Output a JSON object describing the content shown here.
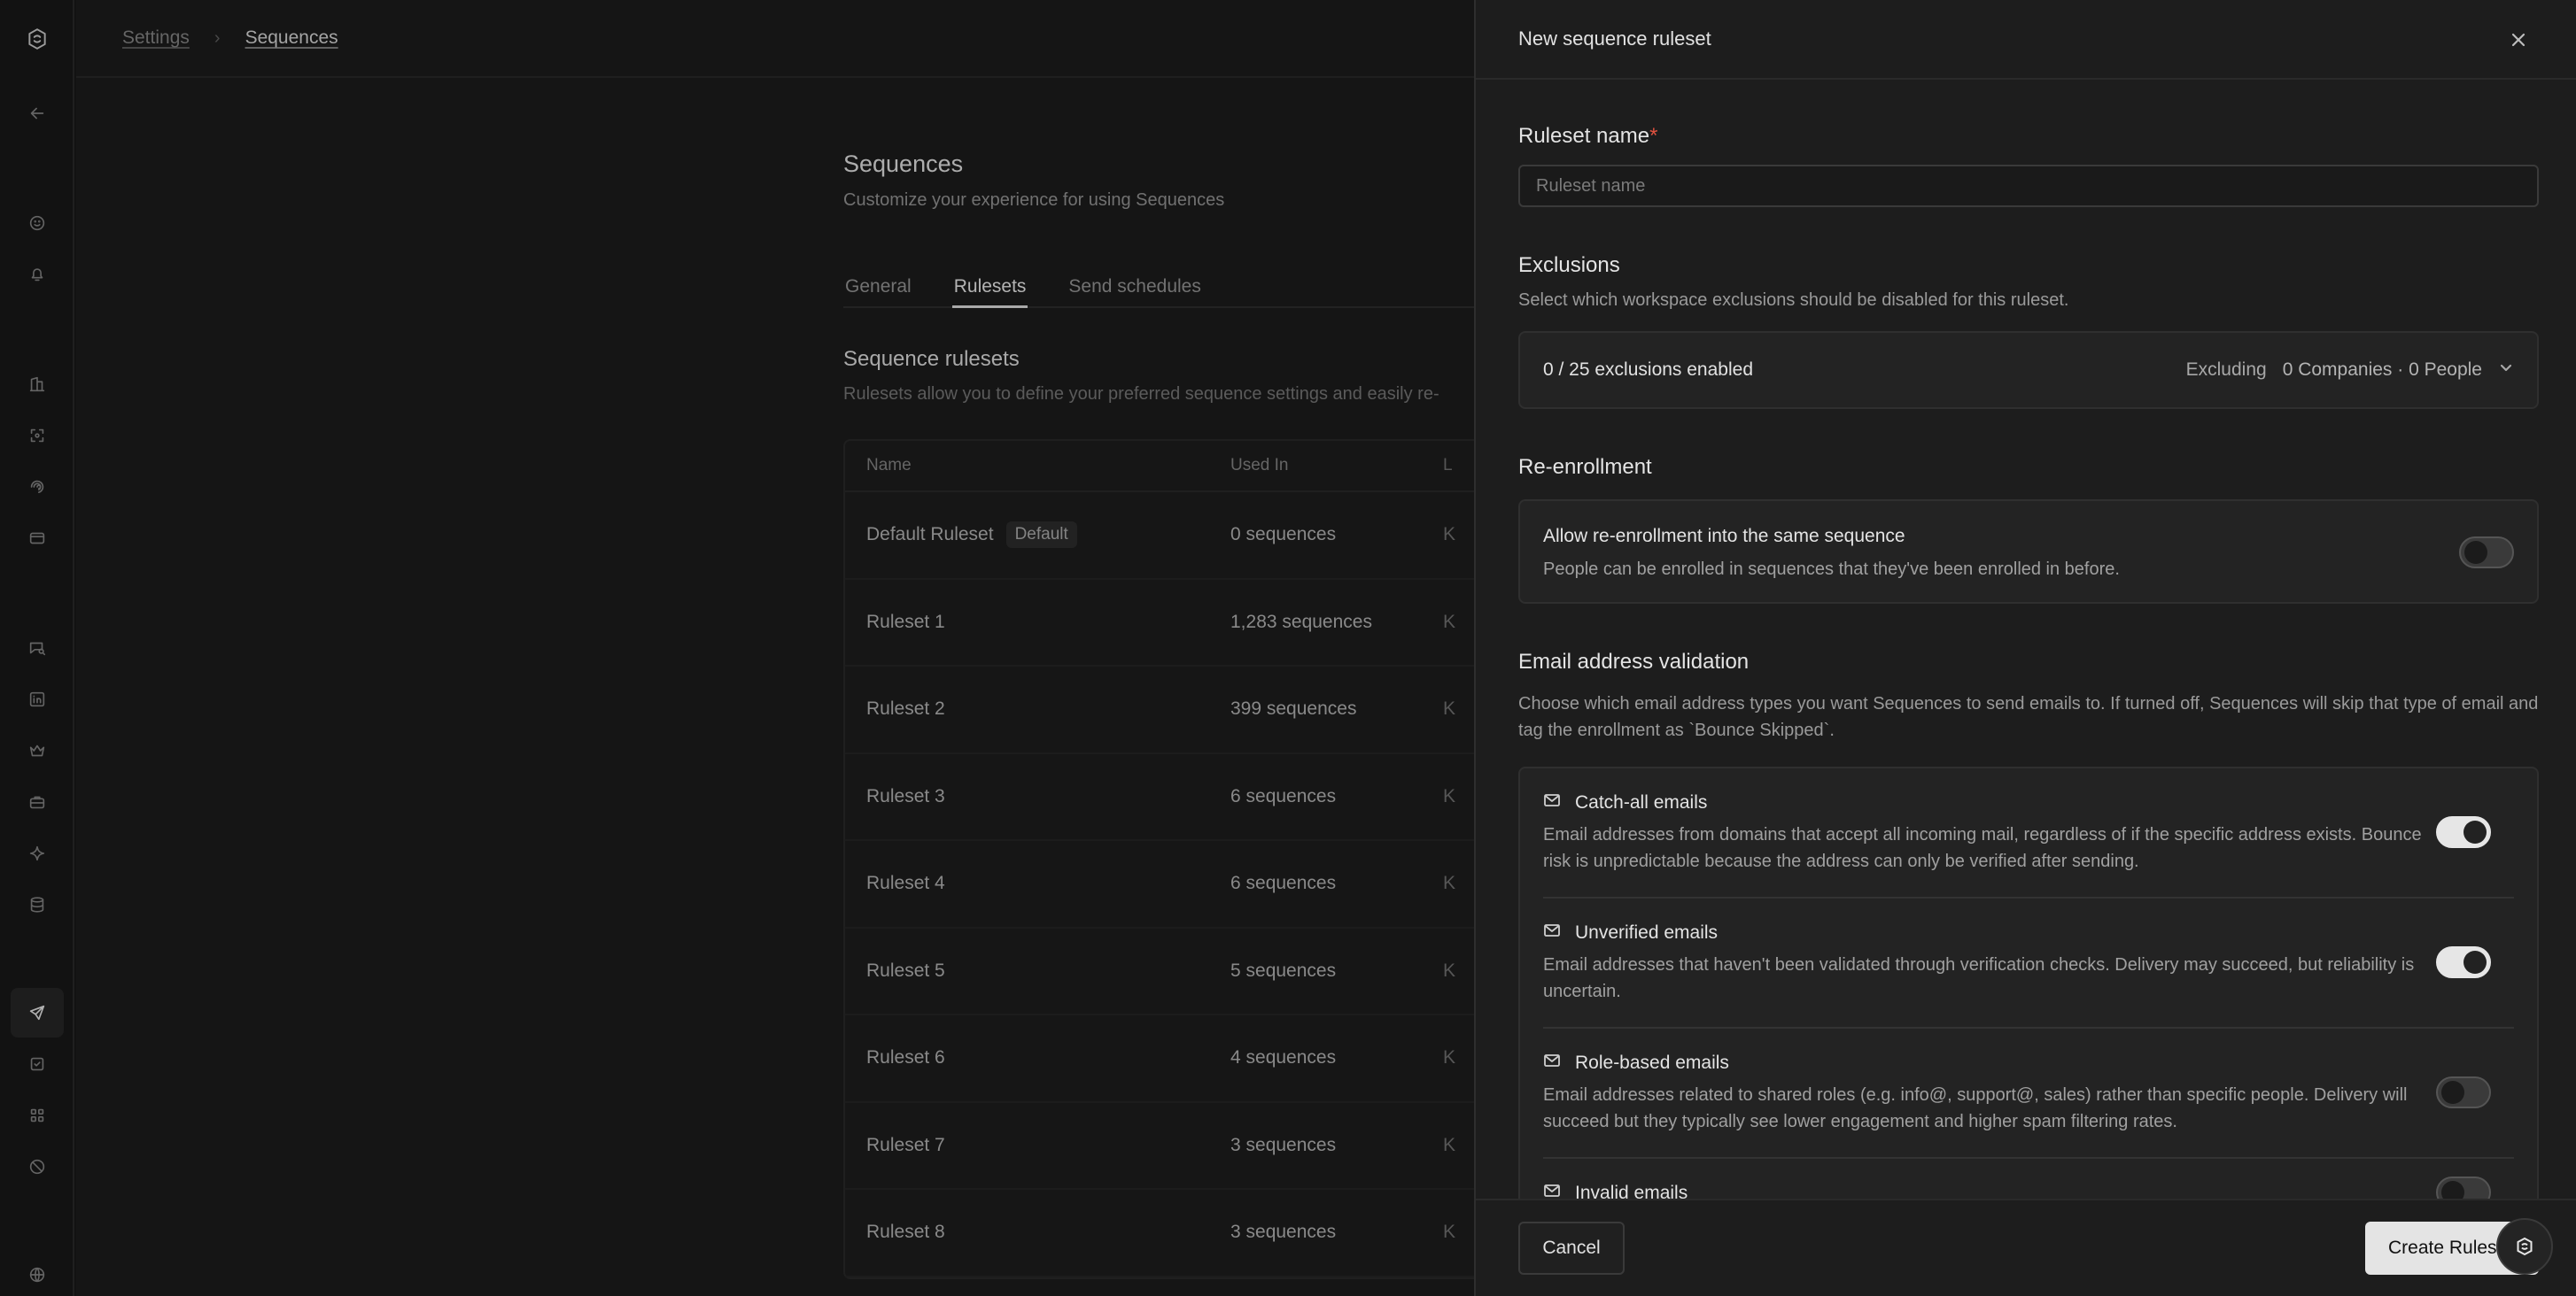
{
  "breadcrumb": {
    "settings": "Settings",
    "current": "Sequences"
  },
  "page": {
    "title": "Sequences",
    "subtitle": "Customize your experience for using Sequences"
  },
  "tabs": [
    {
      "label": "General"
    },
    {
      "label": "Rulesets"
    },
    {
      "label": "Send schedules"
    }
  ],
  "active_tab": "Rulesets",
  "rulesets_section": {
    "title": "Sequence rulesets",
    "description": "Rulesets allow you to define your preferred sequence settings and easily re-"
  },
  "table": {
    "headers": [
      "Name",
      "Used In",
      "L"
    ],
    "rows": [
      {
        "name": "Default Ruleset",
        "badge": "Default",
        "used_in": "0 sequences",
        "last": "K"
      },
      {
        "name": "Ruleset 1",
        "used_in": "1,283 sequences",
        "last": "K"
      },
      {
        "name": "Ruleset 2",
        "used_in": "399 sequences",
        "last": "K"
      },
      {
        "name": "Ruleset 3",
        "used_in": "6 sequences",
        "last": "K"
      },
      {
        "name": "Ruleset 4",
        "used_in": "6 sequences",
        "last": "K"
      },
      {
        "name": "Ruleset 5",
        "used_in": "5 sequences",
        "last": "K"
      },
      {
        "name": "Ruleset 6",
        "used_in": "4 sequences",
        "last": "K"
      },
      {
        "name": "Ruleset 7",
        "used_in": "3 sequences",
        "last": "K"
      },
      {
        "name": "Ruleset 8",
        "used_in": "3 sequences",
        "last": "K"
      }
    ]
  },
  "panel": {
    "title": "New sequence ruleset",
    "name_label": "Ruleset name",
    "required_mark": "*",
    "name_placeholder": "Ruleset name",
    "name_value": "",
    "exclusions": {
      "title": "Exclusions",
      "description": "Select which workspace exclusions should be disabled for this ruleset.",
      "summary": "0 / 25 exclusions enabled",
      "excluding_label": "Excluding",
      "excluding_counts": "0 Companies · 0 People"
    },
    "reenrollment": {
      "title": "Re-enrollment",
      "item_title": "Allow re-enrollment into the same sequence",
      "item_desc": "People can be enrolled in sequences that they've been enrolled in before.",
      "enabled": false
    },
    "validation": {
      "title": "Email address validation",
      "description": "Choose which email address types you want Sequences to send emails to. If turned off, Sequences will skip that type of email and tag the enrollment as `Bounce Skipped`.",
      "items": [
        {
          "title": "Catch-all emails",
          "desc": "Email addresses from domains that accept all incoming mail, regardless of if the specific address exists. Bounce risk is unpredictable because the address can only be verified after sending.",
          "enabled": true
        },
        {
          "title": "Unverified emails",
          "desc": "Email addresses that haven't been validated through verification checks. Delivery may succeed, but reliability is uncertain.",
          "enabled": true
        },
        {
          "title": "Role-based emails",
          "desc": "Email addresses related to shared roles (e.g. info@, support@, sales) rather than specific people. Delivery will succeed but they typically see lower engagement and higher spam filtering rates.",
          "enabled": false
        },
        {
          "title": "Invalid emails",
          "desc": "",
          "enabled": false
        }
      ]
    },
    "cancel_label": "Cancel",
    "create_label": "Create Ruleset"
  },
  "icons": {
    "rail": [
      "logo-icon",
      "back-arrow-icon",
      "smiley-icon",
      "bell-icon",
      "building-icon",
      "scan-icon",
      "signal-icon",
      "card-icon",
      "chat-search-icon",
      "linkedin-icon",
      "crown-icon",
      "briefcase-icon",
      "sparkle-icon",
      "database-icon",
      "send-icon",
      "checkbox-icon",
      "apps-grid-icon",
      "block-icon",
      "globe-icon"
    ]
  }
}
